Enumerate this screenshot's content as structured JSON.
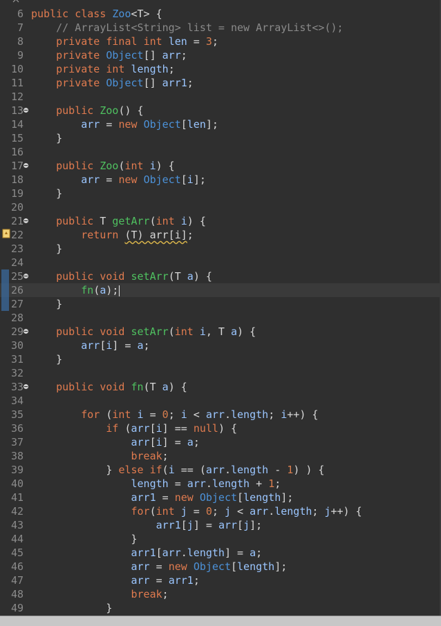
{
  "editor": {
    "current_line": 26,
    "lines": [
      {
        "n": "6",
        "fold": false,
        "tokens": [
          [
            "kw",
            "public "
          ],
          [
            "kw",
            "class "
          ],
          [
            "ty",
            "Zoo"
          ],
          [
            "",
            "<T> {"
          ]
        ]
      },
      {
        "n": "7",
        "fold": false,
        "tokens": [
          [
            "cm",
            "    // ArrayList<String> list = new ArrayList<>();"
          ]
        ]
      },
      {
        "n": "8",
        "fold": false,
        "tokens": [
          [
            "kw",
            "    private "
          ],
          [
            "kw",
            "final "
          ],
          [
            "kw",
            "int "
          ],
          [
            "id",
            "len"
          ],
          [
            "",
            ""
          ],
          [
            "",
            " = "
          ],
          [
            "num",
            "3"
          ],
          [
            "",
            ";"
          ]
        ]
      },
      {
        "n": "9",
        "fold": false,
        "tokens": [
          [
            "kw",
            "    private "
          ],
          [
            "ty",
            "Object"
          ],
          [
            "",
            "[] "
          ],
          [
            "id",
            "arr"
          ],
          [
            "",
            ";"
          ]
        ]
      },
      {
        "n": "10",
        "fold": false,
        "tokens": [
          [
            "kw",
            "    private "
          ],
          [
            "kw",
            "int "
          ],
          [
            "id",
            "length"
          ],
          [
            "",
            ";"
          ]
        ]
      },
      {
        "n": "11",
        "fold": false,
        "tokens": [
          [
            "kw",
            "    private "
          ],
          [
            "ty",
            "Object"
          ],
          [
            "",
            "[] "
          ],
          [
            "id",
            "arr1"
          ],
          [
            "",
            ";"
          ]
        ]
      },
      {
        "n": "12",
        "fold": false,
        "tokens": []
      },
      {
        "n": "13",
        "fold": true,
        "tokens": [
          [
            "kw",
            "    public "
          ],
          [
            "fn",
            "Zoo"
          ],
          [
            "",
            "() {"
          ]
        ]
      },
      {
        "n": "14",
        "fold": false,
        "tokens": [
          [
            "id",
            "        arr"
          ],
          [
            "",
            " = "
          ],
          [
            "kw",
            "new "
          ],
          [
            "ty",
            "Object"
          ],
          [
            "",
            "["
          ],
          [
            "id",
            "len"
          ],
          [
            "",
            "];"
          ]
        ]
      },
      {
        "n": "15",
        "fold": false,
        "tokens": [
          [
            "",
            "    }"
          ]
        ]
      },
      {
        "n": "16",
        "fold": false,
        "tokens": []
      },
      {
        "n": "17",
        "fold": true,
        "tokens": [
          [
            "kw",
            "    public "
          ],
          [
            "fn",
            "Zoo"
          ],
          [
            "",
            "("
          ],
          [
            "kw",
            "int "
          ],
          [
            "id",
            "i"
          ],
          [
            "",
            ") {"
          ]
        ]
      },
      {
        "n": "18",
        "fold": false,
        "tokens": [
          [
            "id",
            "        arr"
          ],
          [
            "",
            " = "
          ],
          [
            "kw",
            "new "
          ],
          [
            "ty",
            "Object"
          ],
          [
            "",
            "["
          ],
          [
            "id",
            "i"
          ],
          [
            "",
            "];"
          ]
        ]
      },
      {
        "n": "19",
        "fold": false,
        "tokens": [
          [
            "",
            "    }"
          ]
        ]
      },
      {
        "n": "20",
        "fold": false,
        "tokens": []
      },
      {
        "n": "21",
        "fold": true,
        "tokens": [
          [
            "kw",
            "    public "
          ],
          [
            "",
            "T "
          ],
          [
            "fn",
            "getArr"
          ],
          [
            "",
            "("
          ],
          [
            "kw",
            "int "
          ],
          [
            "id",
            "i"
          ],
          [
            "",
            ") {"
          ]
        ]
      },
      {
        "n": "22",
        "fold": false,
        "warn": true,
        "tokens": [
          [
            "kw",
            "        return "
          ],
          [
            "warn",
            "(T) arr[i]"
          ],
          [
            "",
            ";"
          ]
        ]
      },
      {
        "n": "23",
        "fold": false,
        "tokens": [
          [
            "",
            "    }"
          ]
        ]
      },
      {
        "n": "24",
        "fold": false,
        "tokens": []
      },
      {
        "n": "25",
        "fold": true,
        "marker": true,
        "tokens": [
          [
            "kw",
            "    public "
          ],
          [
            "kw",
            "void "
          ],
          [
            "fn",
            "setArr"
          ],
          [
            "",
            "(T "
          ],
          [
            "id",
            "a"
          ],
          [
            "",
            ") {"
          ]
        ]
      },
      {
        "n": "26",
        "fold": false,
        "marker": true,
        "caret": true,
        "tokens": [
          [
            "fn",
            "        fn"
          ],
          [
            "",
            "("
          ],
          [
            "id",
            "a"
          ],
          [
            "",
            ");"
          ]
        ]
      },
      {
        "n": "27",
        "fold": false,
        "marker": true,
        "tokens": [
          [
            "",
            "    }"
          ]
        ]
      },
      {
        "n": "28",
        "fold": false,
        "tokens": []
      },
      {
        "n": "29",
        "fold": true,
        "tokens": [
          [
            "kw",
            "    public "
          ],
          [
            "kw",
            "void "
          ],
          [
            "fn",
            "setArr"
          ],
          [
            "",
            "("
          ],
          [
            "kw",
            "int "
          ],
          [
            "id",
            "i"
          ],
          [
            "",
            ", T "
          ],
          [
            "id",
            "a"
          ],
          [
            "",
            ") {"
          ]
        ]
      },
      {
        "n": "30",
        "fold": false,
        "tokens": [
          [
            "id",
            "        arr"
          ],
          [
            "",
            "["
          ],
          [
            "id",
            "i"
          ],
          [
            "",
            "] = "
          ],
          [
            "id",
            "a"
          ],
          [
            "",
            ";"
          ]
        ]
      },
      {
        "n": "31",
        "fold": false,
        "tokens": [
          [
            "",
            "    }"
          ]
        ]
      },
      {
        "n": "32",
        "fold": false,
        "tokens": []
      },
      {
        "n": "33",
        "fold": true,
        "tokens": [
          [
            "kw",
            "    public "
          ],
          [
            "kw",
            "void "
          ],
          [
            "fn",
            "fn"
          ],
          [
            "",
            "(T "
          ],
          [
            "id",
            "a"
          ],
          [
            "",
            ") {"
          ]
        ]
      },
      {
        "n": "34",
        "fold": false,
        "tokens": []
      },
      {
        "n": "35",
        "fold": false,
        "tokens": [
          [
            "kw",
            "        for "
          ],
          [
            "",
            "("
          ],
          [
            "kw",
            "int "
          ],
          [
            "id",
            "i"
          ],
          [
            "",
            " = "
          ],
          [
            "num",
            "0"
          ],
          [
            "",
            "; "
          ],
          [
            "id",
            "i"
          ],
          [
            "",
            " < "
          ],
          [
            "id",
            "arr"
          ],
          [
            "",
            "."
          ],
          [
            "id",
            "length"
          ],
          [
            "",
            "; "
          ],
          [
            "id",
            "i"
          ],
          [
            "",
            "++) {"
          ]
        ]
      },
      {
        "n": "36",
        "fold": false,
        "tokens": [
          [
            "kw",
            "            if "
          ],
          [
            "",
            "("
          ],
          [
            "id",
            "arr"
          ],
          [
            "",
            "["
          ],
          [
            "id",
            "i"
          ],
          [
            "",
            "] == "
          ],
          [
            "kw",
            "null"
          ],
          [
            "",
            ") {"
          ]
        ]
      },
      {
        "n": "37",
        "fold": false,
        "tokens": [
          [
            "id",
            "                arr"
          ],
          [
            "",
            "["
          ],
          [
            "id",
            "i"
          ],
          [
            "",
            "] = "
          ],
          [
            "id",
            "a"
          ],
          [
            "",
            ";"
          ]
        ]
      },
      {
        "n": "38",
        "fold": false,
        "tokens": [
          [
            "kw",
            "                break"
          ],
          [
            "",
            ";"
          ]
        ]
      },
      {
        "n": "39",
        "fold": false,
        "tokens": [
          [
            "",
            "            } "
          ],
          [
            "kw",
            "else if"
          ],
          [
            "",
            "("
          ],
          [
            "id",
            "i"
          ],
          [
            "",
            " == ("
          ],
          [
            "id",
            "arr"
          ],
          [
            "",
            "."
          ],
          [
            "id",
            "length"
          ],
          [
            "",
            " - "
          ],
          [
            "num",
            "1"
          ],
          [
            "",
            ") ) {"
          ]
        ]
      },
      {
        "n": "40",
        "fold": false,
        "tokens": [
          [
            "id",
            "                length"
          ],
          [
            "",
            " = "
          ],
          [
            "id",
            "arr"
          ],
          [
            "",
            "."
          ],
          [
            "id",
            "length"
          ],
          [
            "",
            " + "
          ],
          [
            "num",
            "1"
          ],
          [
            "",
            ";"
          ]
        ]
      },
      {
        "n": "41",
        "fold": false,
        "tokens": [
          [
            "id",
            "                arr1"
          ],
          [
            "",
            " = "
          ],
          [
            "kw",
            "new "
          ],
          [
            "ty",
            "Object"
          ],
          [
            "",
            "["
          ],
          [
            "id",
            "length"
          ],
          [
            "",
            "];"
          ]
        ]
      },
      {
        "n": "42",
        "fold": false,
        "tokens": [
          [
            "kw",
            "                for"
          ],
          [
            "",
            "("
          ],
          [
            "kw",
            "int "
          ],
          [
            "id",
            "j"
          ],
          [
            "",
            " = "
          ],
          [
            "num",
            "0"
          ],
          [
            "",
            "; "
          ],
          [
            "id",
            "j"
          ],
          [
            "",
            " < "
          ],
          [
            "id",
            "arr"
          ],
          [
            "",
            "."
          ],
          [
            "id",
            "length"
          ],
          [
            "",
            "; "
          ],
          [
            "id",
            "j"
          ],
          [
            "",
            "++) {"
          ]
        ]
      },
      {
        "n": "43",
        "fold": false,
        "tokens": [
          [
            "id",
            "                    arr1"
          ],
          [
            "",
            "["
          ],
          [
            "id",
            "j"
          ],
          [
            "",
            "] = "
          ],
          [
            "id",
            "arr"
          ],
          [
            "",
            "["
          ],
          [
            "id",
            "j"
          ],
          [
            "",
            "];"
          ]
        ]
      },
      {
        "n": "44",
        "fold": false,
        "tokens": [
          [
            "",
            "                }"
          ]
        ]
      },
      {
        "n": "45",
        "fold": false,
        "tokens": [
          [
            "id",
            "                arr1"
          ],
          [
            "",
            "["
          ],
          [
            "id",
            "arr"
          ],
          [
            "",
            "."
          ],
          [
            "id",
            "length"
          ],
          [
            "",
            "] = "
          ],
          [
            "id",
            "a"
          ],
          [
            "",
            ";"
          ]
        ]
      },
      {
        "n": "46",
        "fold": false,
        "tokens": [
          [
            "id",
            "                arr"
          ],
          [
            "",
            " = "
          ],
          [
            "kw",
            "new "
          ],
          [
            "ty",
            "Object"
          ],
          [
            "",
            "["
          ],
          [
            "id",
            "length"
          ],
          [
            "",
            "];"
          ]
        ]
      },
      {
        "n": "47",
        "fold": false,
        "tokens": [
          [
            "id",
            "                arr"
          ],
          [
            "",
            " = "
          ],
          [
            "id",
            "arr1"
          ],
          [
            "",
            ";"
          ]
        ]
      },
      {
        "n": "48",
        "fold": false,
        "tokens": [
          [
            "kw",
            "                break"
          ],
          [
            "",
            ";"
          ]
        ]
      },
      {
        "n": "49",
        "fold": false,
        "tokens": [
          [
            "",
            "            }"
          ]
        ]
      }
    ]
  }
}
